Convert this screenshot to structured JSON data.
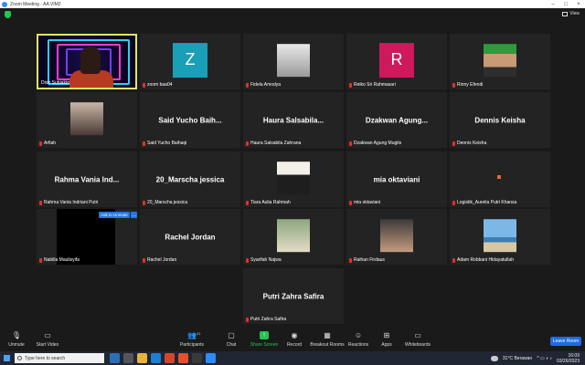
{
  "window": {
    "title": "Zoom Meeting - AA VIM2"
  },
  "topbar": {
    "view_label": "View"
  },
  "participants": [
    {
      "name": "Dion Subiakto",
      "type": "video"
    },
    {
      "name": "zoom baa04",
      "type": "letter",
      "letter": "Z",
      "color": "#1a9fb8"
    },
    {
      "name": "Fidela Amodya",
      "type": "photo",
      "photo": "bw-portrait"
    },
    {
      "name": "Reiko Sri Rahmasari",
      "type": "letter",
      "letter": "R",
      "color": "#d0185c"
    },
    {
      "name": "Rinny Efendi",
      "type": "photo",
      "photo": "green-cap"
    },
    {
      "name": "Arfiah",
      "type": "photo",
      "photo": "sunset-silhouette"
    },
    {
      "name": "Said Yucho Baihaqi",
      "type": "text",
      "display": "Said Yucho Baih..."
    },
    {
      "name": "Haura Salsabila Zahrana",
      "type": "text",
      "display": "Haura Salsabila..."
    },
    {
      "name": "Dzakwan Agung Mugits",
      "type": "text",
      "display": "Dzakwan Agung..."
    },
    {
      "name": "Dennis Keisha",
      "type": "text",
      "display": "Dennis Keisha"
    },
    {
      "name": "Rahma Vania Indriani Putri",
      "type": "text",
      "display": "Rahma Vania Ind..."
    },
    {
      "name": "20_Marscha jessica",
      "type": "text",
      "display": "20_Marscha jessica"
    },
    {
      "name": "Tiara Aulia Rahmah",
      "type": "photo",
      "photo": "dark-hair"
    },
    {
      "name": "mia oktaviani",
      "type": "text",
      "display": "mia oktaviani"
    },
    {
      "name": "Logistik_Aurelia Putri Khansa",
      "type": "dot"
    },
    {
      "name": "Nabilla Maulisyifa",
      "type": "blackvideo"
    },
    {
      "name": "Rachel Jordan",
      "type": "text",
      "display": "Rachel Jordan"
    },
    {
      "name": "Syarifah Najwa",
      "type": "photo",
      "photo": "hijab-portrait"
    },
    {
      "name": "Raihan Firdaus",
      "type": "photo",
      "photo": "boy-portrait"
    },
    {
      "name": "Adam Robbani Hidayatullah",
      "type": "photo",
      "photo": "beach"
    },
    {
      "name": "Putri Zahra Safira",
      "type": "text",
      "display": "Putri Zahra Safira"
    }
  ],
  "ask_to_unmute": {
    "label": "Ask to Unmute",
    "more": "…"
  },
  "toolbar": {
    "unmute": "Unmute",
    "start_video": "Start Video",
    "participants": "Participants",
    "participants_count": "21",
    "chat": "Chat",
    "share": "Share Screen",
    "record": "Record",
    "breakout": "Breakout Rooms",
    "reactions": "Reactions",
    "apps": "Apps",
    "whiteboards": "Whiteboards",
    "leave": "Leave Room"
  },
  "taskbar": {
    "search_placeholder": "Type here to search",
    "weather": "31°C  Berawan",
    "time": "16:09",
    "date": "03/26/2023"
  }
}
